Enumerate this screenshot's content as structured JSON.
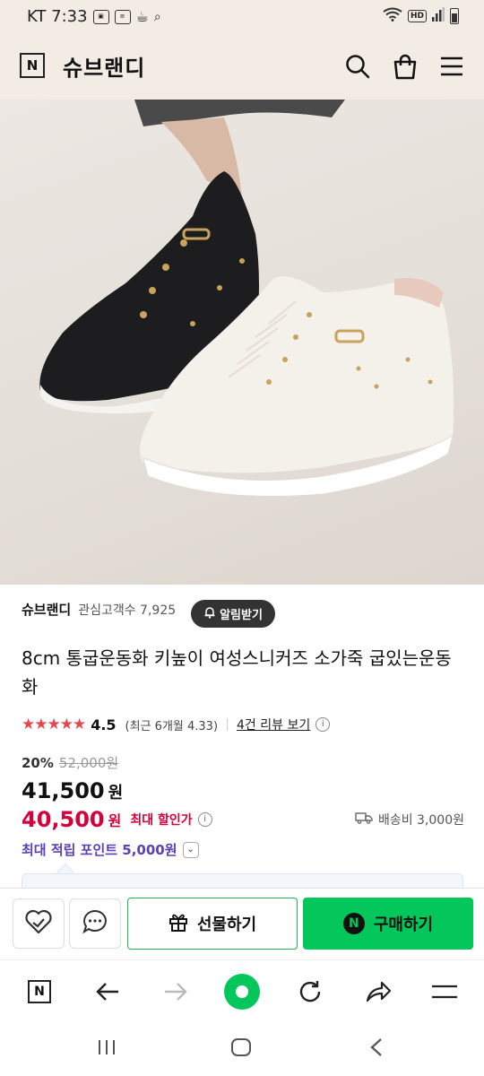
{
  "status_bar": {
    "carrier_time": "KT 7:33",
    "hd_label": "HD",
    "notif_icons": [
      "photo-icon",
      "news-icon",
      "cup-icon",
      "chart-search-icon"
    ]
  },
  "header": {
    "logo_letter": "N",
    "brand": "슈브랜디"
  },
  "product": {
    "image_alt": "black and white quilted sneakers",
    "store_name": "슈브랜디",
    "fans": "관심고객수 7,925",
    "alarm_label": "알림받기",
    "title": "8cm 통굽운동화 키높이 여성스니커즈 소가죽 굽있는운동화",
    "rating": {
      "stars": "★★★★★",
      "score": "4.5",
      "recent": "(최근 6개월 4.33)",
      "reviews_link": "4건 리뷰 보기",
      "info": "i"
    },
    "discount_rate": "20%",
    "original_price": "52,000원",
    "sale_price": "41,500",
    "won": "원",
    "max_discount_price": "40,500",
    "max_discount_won": "원",
    "max_discount_label": "최대 할인가",
    "shipping": "배송비 3,000원",
    "points": "최대 적립 포인트 5,000원"
  },
  "actions": {
    "gift_label": "선물하기",
    "buy_label": "구매하기",
    "buy_logo": "N"
  },
  "browser_nav": {
    "logo_letter": "N"
  },
  "colors": {
    "accent_green": "#03c75a",
    "price_red": "#d6003b",
    "points_purple": "#5a3fb5",
    "header_beige": "#f3ece4"
  }
}
